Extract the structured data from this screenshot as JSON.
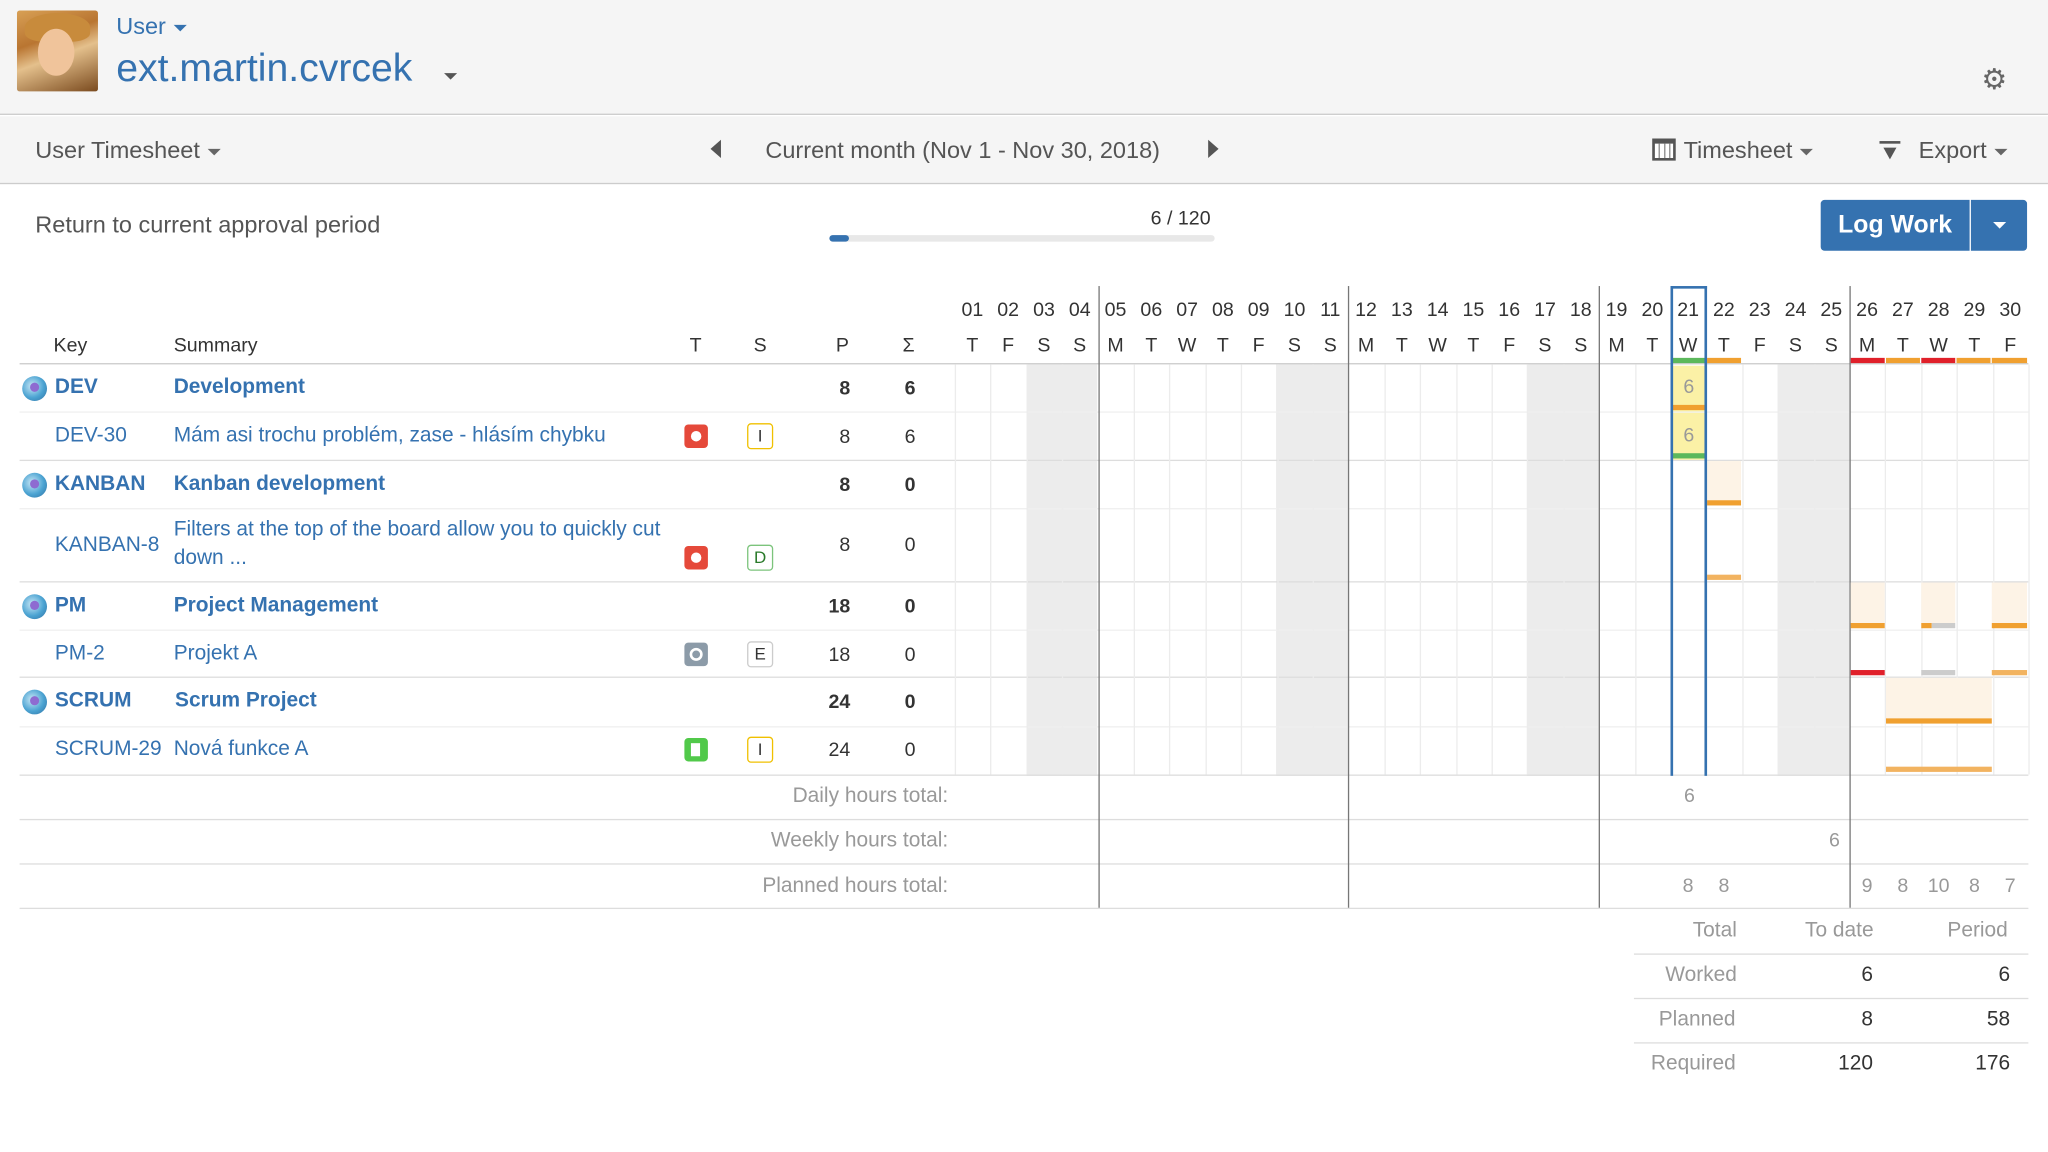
{
  "header": {
    "user_label": "User",
    "user_name": "ext.martin.cvrcek",
    "settings_icon": "gear-icon"
  },
  "toolbar": {
    "view_label": "User Timesheet",
    "period_label": "Current month (Nov 1 - Nov 30, 2018)",
    "timesheet_label": "Timesheet",
    "export_label": "Export"
  },
  "approval": {
    "return_label": "Return to current approval period",
    "progress_text": "6 / 120",
    "progress_fraction": 0.05
  },
  "log_work": {
    "label": "Log Work"
  },
  "columns": {
    "key": "Key",
    "summary": "Summary",
    "type": "T",
    "status": "S",
    "planned": "P",
    "sum": "Σ"
  },
  "days": {
    "numbers": [
      "01",
      "02",
      "03",
      "04",
      "05",
      "06",
      "07",
      "08",
      "09",
      "10",
      "11",
      "12",
      "13",
      "14",
      "15",
      "16",
      "17",
      "18",
      "19",
      "20",
      "21",
      "22",
      "23",
      "24",
      "25",
      "26",
      "27",
      "28",
      "29",
      "30"
    ],
    "weekdays": [
      "T",
      "F",
      "S",
      "S",
      "M",
      "T",
      "W",
      "T",
      "F",
      "S",
      "S",
      "M",
      "T",
      "W",
      "T",
      "F",
      "S",
      "S",
      "M",
      "T",
      "W",
      "T",
      "F",
      "S",
      "S",
      "M",
      "T",
      "W",
      "T",
      "F"
    ]
  },
  "rows": [
    {
      "key": "DEV",
      "summary": "Development",
      "planned": "8",
      "sum": "6",
      "group": true
    },
    {
      "key": "DEV-30",
      "summary": "Mám asi trochu problém, zase - hlásím chybku",
      "planned": "8",
      "sum": "6",
      "type": "bug",
      "status": "I"
    },
    {
      "key": "KANBAN",
      "summary": "Kanban development",
      "planned": "8",
      "sum": "0",
      "group": true
    },
    {
      "key": "KANBAN-8",
      "summary_line1": "Filters at the top of the board allow you to quickly cut",
      "summary_line2": "down ...",
      "planned": "8",
      "sum": "0",
      "type": "bug",
      "status": "D"
    },
    {
      "key": "PM",
      "summary": "Project Management",
      "planned": "18",
      "sum": "0",
      "group": true
    },
    {
      "key": "PM-2",
      "summary": "Projekt A",
      "planned": "18",
      "sum": "0",
      "type": "task",
      "status": "E"
    },
    {
      "key": "SCRUM",
      "summary": "Scrum Project",
      "planned": "24",
      "sum": "0",
      "group": true
    },
    {
      "key": "SCRUM-29",
      "summary": "Nová funkce A",
      "planned": "24",
      "sum": "0",
      "type": "story",
      "status": "I"
    }
  ],
  "cell_values": {
    "dev_21": "6",
    "dev30_21": "6"
  },
  "totals": {
    "daily_label": "Daily hours total:",
    "weekly_label": "Weekly hours total:",
    "planned_label": "Planned hours total:",
    "daily_21": "6",
    "weekly_25": "6",
    "planned": [
      {
        "day": "21",
        "value": "8"
      },
      {
        "day": "22",
        "value": "8"
      },
      {
        "day": "26",
        "value": "9"
      },
      {
        "day": "27",
        "value": "8"
      },
      {
        "day": "28",
        "value": "10"
      },
      {
        "day": "29",
        "value": "8"
      },
      {
        "day": "30",
        "value": "7"
      }
    ]
  },
  "summary": {
    "header_total": "Total",
    "header_todate": "To date",
    "header_period": "Period",
    "worked_label": "Worked",
    "worked_todate": "6",
    "worked_period": "6",
    "planned_label": "Planned",
    "planned_todate": "8",
    "planned_period": "58",
    "required_label": "Required",
    "required_todate": "120",
    "required_period": "176"
  },
  "colors": {
    "accent": "#3572b0",
    "planned_bar": "#f0a030",
    "over_bar": "#e0202a",
    "worked_bar": "#5cb85c",
    "cell_highlight": "#fbf1a6"
  }
}
